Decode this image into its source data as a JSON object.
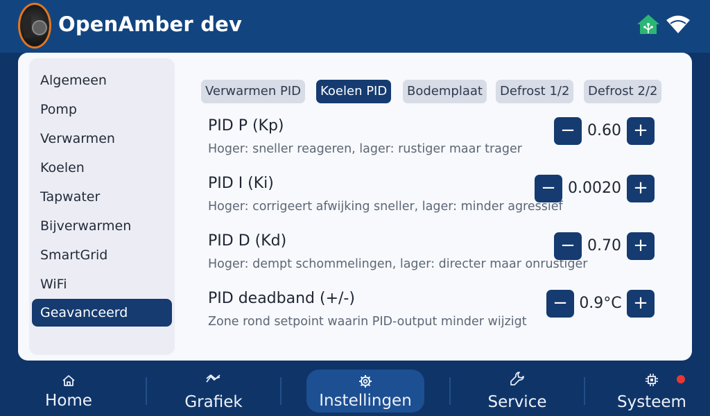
{
  "header": {
    "title": "OpenAmber dev",
    "icons": [
      "logo-icon",
      "home-assistant-icon",
      "wifi-icon"
    ]
  },
  "sidebar": {
    "items": [
      {
        "label": "Algemeen"
      },
      {
        "label": "Pomp"
      },
      {
        "label": "Verwarmen"
      },
      {
        "label": "Koelen"
      },
      {
        "label": "Tapwater"
      },
      {
        "label": "Bijverwarmen"
      },
      {
        "label": "SmartGrid"
      },
      {
        "label": "WiFi"
      },
      {
        "label": "Geavanceerd",
        "active": true
      }
    ]
  },
  "tabs": [
    {
      "label": "Verwarmen PID"
    },
    {
      "label": "Koelen PID",
      "active": true
    },
    {
      "label": "Bodemplaat"
    },
    {
      "label": "Defrost 1/2"
    },
    {
      "label": "Defrost 2/2"
    }
  ],
  "settings": [
    {
      "label": "PID P (Kp)",
      "description": "Hoger: sneller reageren, lager: rustiger maar trager",
      "value": "0.60"
    },
    {
      "label": "PID I (Ki)",
      "description": "Hoger: corrigeert afwijking sneller, lager: minder agressief",
      "value": "0.0020"
    },
    {
      "label": "PID D (Kd)",
      "description": "Hoger: dempt schommelingen, lager: directer maar onrustiger",
      "value": "0.70"
    },
    {
      "label": "PID deadband (+/-)",
      "description": "Zone rond setpoint waarin PID-output minder wijzigt",
      "value": "0.9°C"
    }
  ],
  "stepper": {
    "minus": "−",
    "plus": "+"
  },
  "nav": {
    "items": [
      {
        "label": "Home",
        "icon": "home-icon"
      },
      {
        "label": "Grafiek",
        "icon": "chart-icon"
      },
      {
        "label": "Instellingen",
        "icon": "gear-icon",
        "active": true
      },
      {
        "label": "Service",
        "icon": "wrench-icon"
      },
      {
        "label": "Systeem",
        "icon": "chip-icon"
      }
    ]
  },
  "colors": {
    "header": "#124580",
    "accent": "#153b70",
    "card": "#f7f9fc",
    "alert": "#e53935",
    "home_assistant": "#2bb673"
  }
}
